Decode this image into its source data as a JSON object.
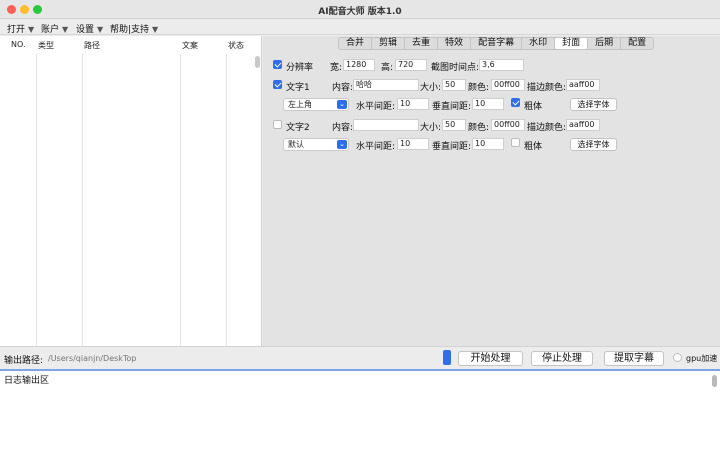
{
  "window": {
    "title": "AI配音大师 版本1.0"
  },
  "menubar": [
    "打开",
    "账户",
    "设置",
    "帮助|支持"
  ],
  "list": {
    "columns": [
      "NO.",
      "类型",
      "路径",
      "文案",
      "状态"
    ]
  },
  "tabs": [
    {
      "label": "合并",
      "active": false
    },
    {
      "label": "剪辑",
      "active": false
    },
    {
      "label": "去重",
      "active": false
    },
    {
      "label": "特效",
      "active": false
    },
    {
      "label": "配音字幕",
      "active": false
    },
    {
      "label": "水印",
      "active": false
    },
    {
      "label": "封面",
      "active": true
    },
    {
      "label": "后期",
      "active": false
    },
    {
      "label": "配置",
      "active": false
    }
  ],
  "cover": {
    "resolution": {
      "checked": true,
      "label": "分辨率",
      "width_label": "宽:",
      "width_value": "1280",
      "height_label": "高:",
      "height_value": "720",
      "capture_label": "截图时间点:",
      "capture_value": "3,6"
    },
    "text1": {
      "checked": true,
      "label": "文字1",
      "content_label": "内容:",
      "content_value": "哈哈",
      "size_label": "大小:",
      "size_value": "50",
      "color_label": "颜色:",
      "color_value": "00ff00",
      "stroke_label": "描边颜色:",
      "stroke_value": "aaff00",
      "position_value": "左上角",
      "hspace_label": "水平间距:",
      "hspace_value": "10",
      "vspace_label": "垂直间距:",
      "vspace_value": "10",
      "bold_checked": true,
      "bold_label": "粗体",
      "font_button": "选择字体"
    },
    "text2": {
      "checked": false,
      "label": "文字2",
      "content_label": "内容:",
      "content_value": "",
      "size_label": "大小:",
      "size_value": "50",
      "color_label": "颜色:",
      "color_value": "00ff00",
      "stroke_label": "描边颜色:",
      "stroke_value": "aaff00",
      "position_value": "默认",
      "hspace_label": "水平间距:",
      "hspace_value": "10",
      "vspace_label": "垂直间距:",
      "vspace_value": "10",
      "bold_checked": false,
      "bold_label": "粗体",
      "font_button": "选择字体"
    }
  },
  "bottom": {
    "output_label": "输出路径:",
    "output_placeholder": "/Users/qianjn/DeskTop",
    "start_button": "开始处理",
    "stop_button": "停止处理",
    "extract_button": "提取字幕",
    "gpu_label": "gpu加速"
  },
  "log": {
    "text": "日志输出区"
  },
  "colors": {
    "accent": "#2f6ee8",
    "active_tab": "#ffffff",
    "divider": "#7da3e8"
  }
}
